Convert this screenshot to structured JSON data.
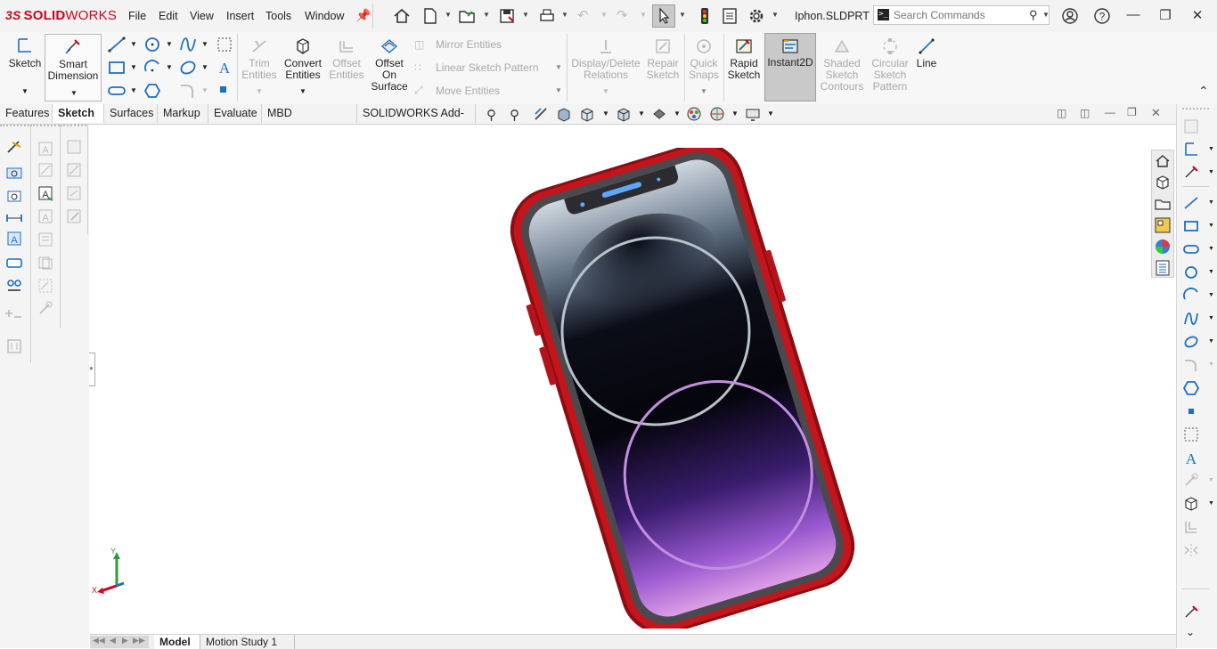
{
  "app": {
    "brand_prefix": "3S",
    "brand_name": "SOLID",
    "brand_suffix": "WORKS"
  },
  "menu": [
    "File",
    "Edit",
    "View",
    "Insert",
    "Tools",
    "Window"
  ],
  "document": {
    "title": "Iphon.SLDPRT"
  },
  "search": {
    "placeholder": "Search Commands"
  },
  "ribbon": {
    "sketch": "Sketch",
    "smart_dimension_l1": "Smart",
    "smart_dimension_l2": "Dimension",
    "trim_l1": "Trim",
    "trim_l2": "Entities",
    "convert_l1": "Convert",
    "convert_l2": "Entities",
    "offset_l1": "Offset",
    "offset_l2": "Entities",
    "offset_surface_l1": "Offset",
    "offset_surface_l2": "On",
    "offset_surface_l3": "Surface",
    "mirror": "Mirror Entities",
    "linear_pattern": "Linear Sketch Pattern",
    "move": "Move Entities",
    "display_delete_l1": "Display/Delete",
    "display_delete_l2": "Relations",
    "repair_l1": "Repair",
    "repair_l2": "Sketch",
    "quick_snaps_l1": "Quick",
    "quick_snaps_l2": "Snaps",
    "rapid_l1": "Rapid",
    "rapid_l2": "Sketch",
    "instant2d": "Instant2D",
    "shaded_l1": "Shaded",
    "shaded_l2": "Sketch",
    "shaded_l3": "Contours",
    "circular_l1": "Circular",
    "circular_l2": "Sketch",
    "circular_l3": "Pattern",
    "line": "Line"
  },
  "tabs": [
    "Features",
    "Sketch",
    "Surfaces",
    "Markup",
    "Evaluate",
    "MBD Dimensions",
    "SOLIDWORKS Add-Ins"
  ],
  "active_tab": "Sketch",
  "bottom_tabs": [
    "Model",
    "Motion Study 1"
  ],
  "triad": {
    "y": "Y",
    "x": "X"
  },
  "colors": {
    "accent": "#1e6fc4",
    "brand": "#d0021b",
    "phone_frame": "#b51217",
    "pressed": "#c9c9c9"
  }
}
